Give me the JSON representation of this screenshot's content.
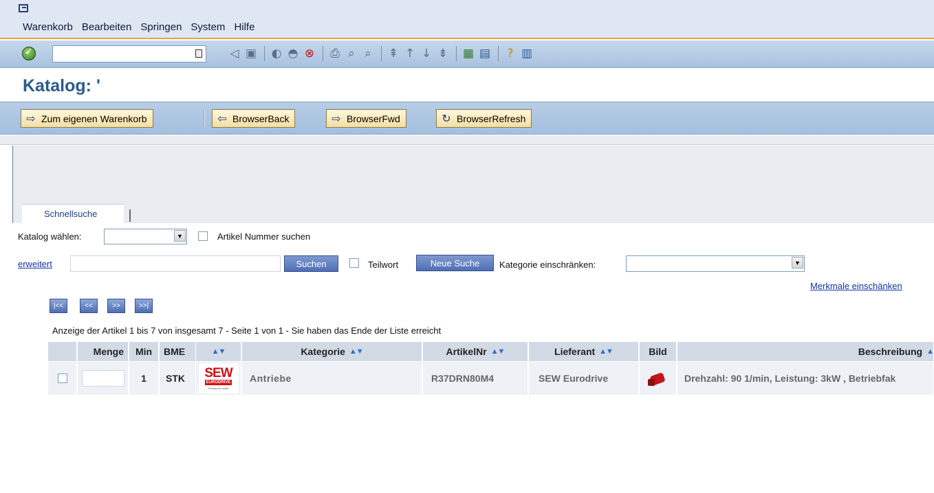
{
  "menu": {
    "items": [
      "Warenkorb",
      "Bearbeiten",
      "Springen",
      "System",
      "Hilfe"
    ]
  },
  "toolbar": {
    "command_value": ""
  },
  "title": {
    "text": "Katalog: '"
  },
  "app_toolbar": {
    "to_cart": "Zum eigenen Warenkorb",
    "back": "BrowserBack",
    "forward": "BrowserFwd",
    "refresh": "BrowserRefresh"
  },
  "tabs": {
    "quick_search": "Schnellsuche"
  },
  "search": {
    "catalog_label": "Katalog wählen:",
    "catalog_value": "",
    "article_number_label": "Artikel Nummer suchen",
    "extended_link": "erweitert",
    "query_value": "",
    "search_button": "Suchen",
    "partial_word_label": "Teilwort",
    "new_search_button": "Neue Suche",
    "category_restrict_label": "Kategorie einschränken:",
    "category_value": "",
    "features_link": "Merkmale einschänken"
  },
  "pager": {
    "first": "|<<",
    "prev": "<<",
    "next": ">>",
    "last": ">>|"
  },
  "results": {
    "summary": "Anzeige der Artikel 1 bis 7 von insgesamt 7 - Seite 1 von 1 - Sie haben das Ende der Liste erreicht",
    "columns": {
      "menge": "Menge",
      "min": "Min",
      "bme": "BME",
      "kategorie": "Kategorie",
      "artikelnr": "ArtikelNr",
      "lieferant": "Lieferant",
      "bild": "Bild",
      "beschreibung": "Beschreibung"
    },
    "rows": [
      {
        "menge": "",
        "min": "1",
        "bme": "STK",
        "logo_text": "SEW",
        "logo_sub": "EURODRIVE",
        "logo_tag": "Driving the world",
        "kategorie": "Antriebe",
        "artikelnr": "R37DRN80M4",
        "lieferant": "SEW Eurodrive",
        "beschreibung": "Drehzahl: 90 1/min, Leistung: 3kW , Betriebfak"
      }
    ]
  },
  "colors": {
    "menubar_bg": "#dfe7f3",
    "toolbar_accent": "#e8a33c",
    "title_color": "#2a5a8c",
    "blue_button": "#4f6fb5",
    "sort_arrow": "#2a6bd2",
    "sew_red": "#d40d14"
  }
}
